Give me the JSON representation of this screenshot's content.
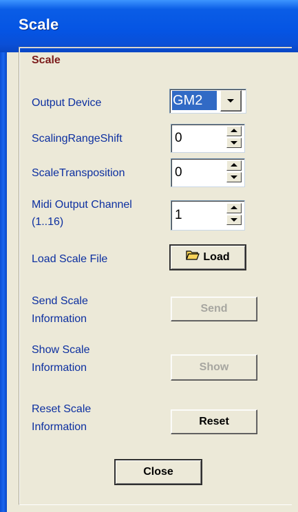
{
  "window": {
    "title": "Scale"
  },
  "group": {
    "title": "Scale"
  },
  "output_device": {
    "label": "Output Device",
    "value": "GM2"
  },
  "scaling_range_shift": {
    "label": "ScalingRangeShift",
    "value": "0"
  },
  "scale_transposition": {
    "label": "ScaleTransposition",
    "value": "0"
  },
  "midi_output_channel": {
    "label_line1": "Midi Output Channel",
    "label_line2": "(1..16)",
    "value": "1"
  },
  "load_scale_file": {
    "label": "Load Scale File",
    "button_label": "Load",
    "icon": "folder-open-icon"
  },
  "send_scale_information": {
    "label_line1": "Send Scale",
    "label_line2": "Information",
    "button_label": "Send",
    "enabled": false
  },
  "show_scale_information": {
    "label_line1": "Show Scale",
    "label_line2": "Information",
    "button_label": "Show",
    "enabled": false
  },
  "reset_scale_information": {
    "label_line1": "Reset Scale",
    "label_line2": "Information",
    "button_label": "Reset",
    "enabled": true
  },
  "close": {
    "button_label": "Close"
  },
  "colors": {
    "title_bar": "#0554e3",
    "client_bg": "#ece9d8",
    "label_text": "#0c2fa0",
    "group_title": "#7a1a1a",
    "selection": "#316ac5",
    "disabled_text": "#a7a6a0"
  }
}
